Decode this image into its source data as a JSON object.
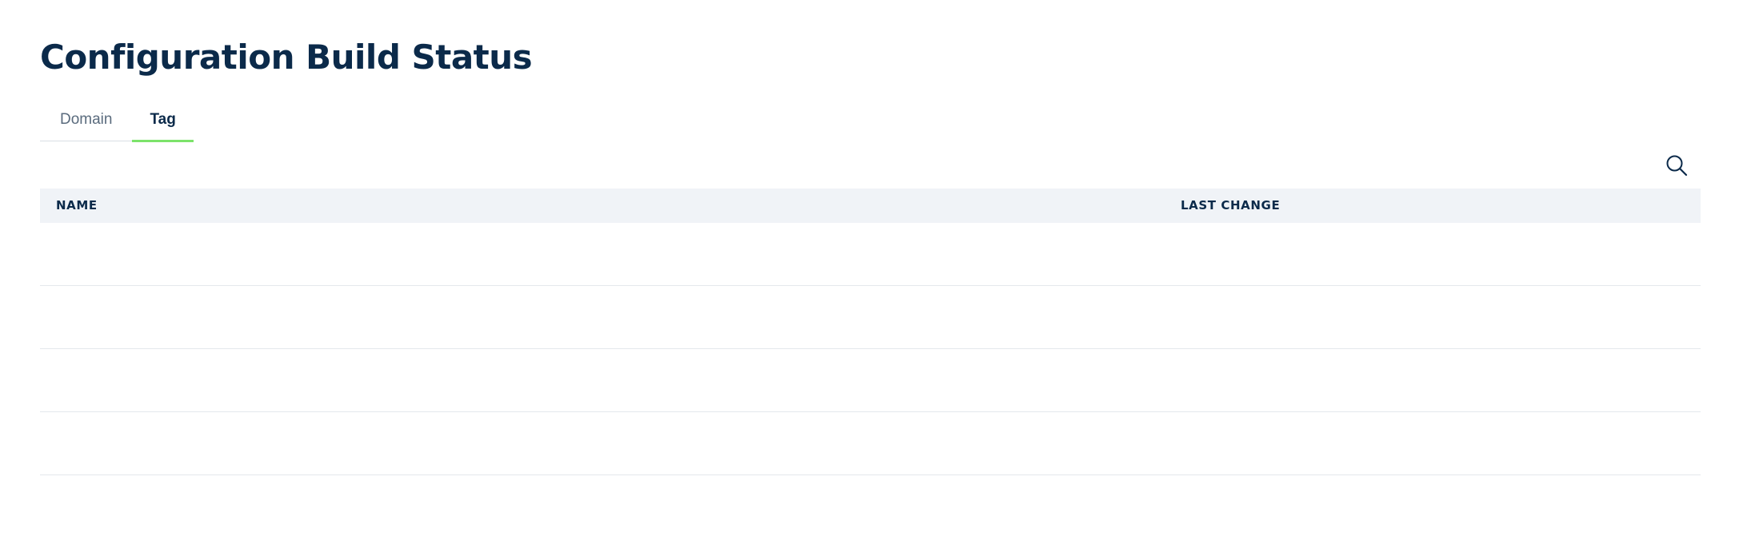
{
  "page": {
    "title": "Configuration Build Status"
  },
  "tabs": [
    {
      "label": "Domain",
      "active": false
    },
    {
      "label": "Tag",
      "active": true
    }
  ],
  "colors": {
    "title": "#0b2a4a",
    "tab_active_underline": "#7ce36a",
    "table_header_bg": "#f0f3f7",
    "row_divider": "#e4e8ec"
  },
  "toolbar": {
    "search_icon": "search-icon"
  },
  "table": {
    "columns": [
      "NAME",
      "LAST CHANGE"
    ],
    "rows": [
      [],
      [],
      [],
      []
    ]
  }
}
